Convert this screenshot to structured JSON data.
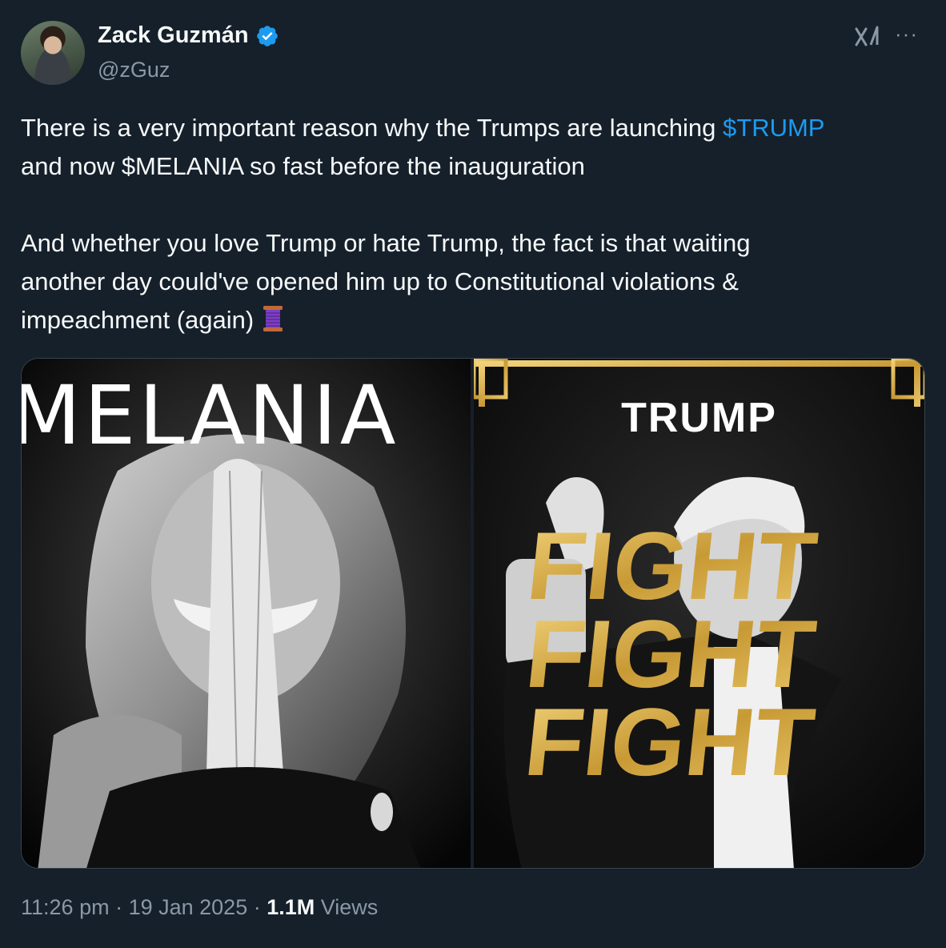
{
  "author": {
    "name": "Zack Guzmán",
    "handle": "@zGuz"
  },
  "tweet": {
    "line1_pre": "There is a very important reason why the Trumps are launching ",
    "cashtag": "$TRUMP",
    "line1_post": "\nand now $MELANIA so fast before the inauguration\n\nAnd whether you love Trump or hate Trump, the fact is that waiting\nanother day could've opened him up to Constitutional violations &\nimpeachment (again) "
  },
  "media": {
    "left": {
      "title": "MELANIA"
    },
    "right": {
      "title": "TRUMP",
      "words": [
        "FIGHT",
        "FIGHT",
        "FIGHT"
      ]
    }
  },
  "meta": {
    "time": "11:26 pm",
    "sep1": " · ",
    "date": "19 Jan 2025",
    "sep2": " · ",
    "views_count": "1.1M",
    "views_label": " Views"
  },
  "colors": {
    "background": "#15202b",
    "text": "#f7f9f9",
    "secondary": "#8b98a5",
    "link": "#1d9bf0",
    "gold": "#d4a63a"
  },
  "icons": [
    "verified-badge-icon",
    "grok-icon",
    "more-options-icon",
    "thread-spool-icon"
  ]
}
